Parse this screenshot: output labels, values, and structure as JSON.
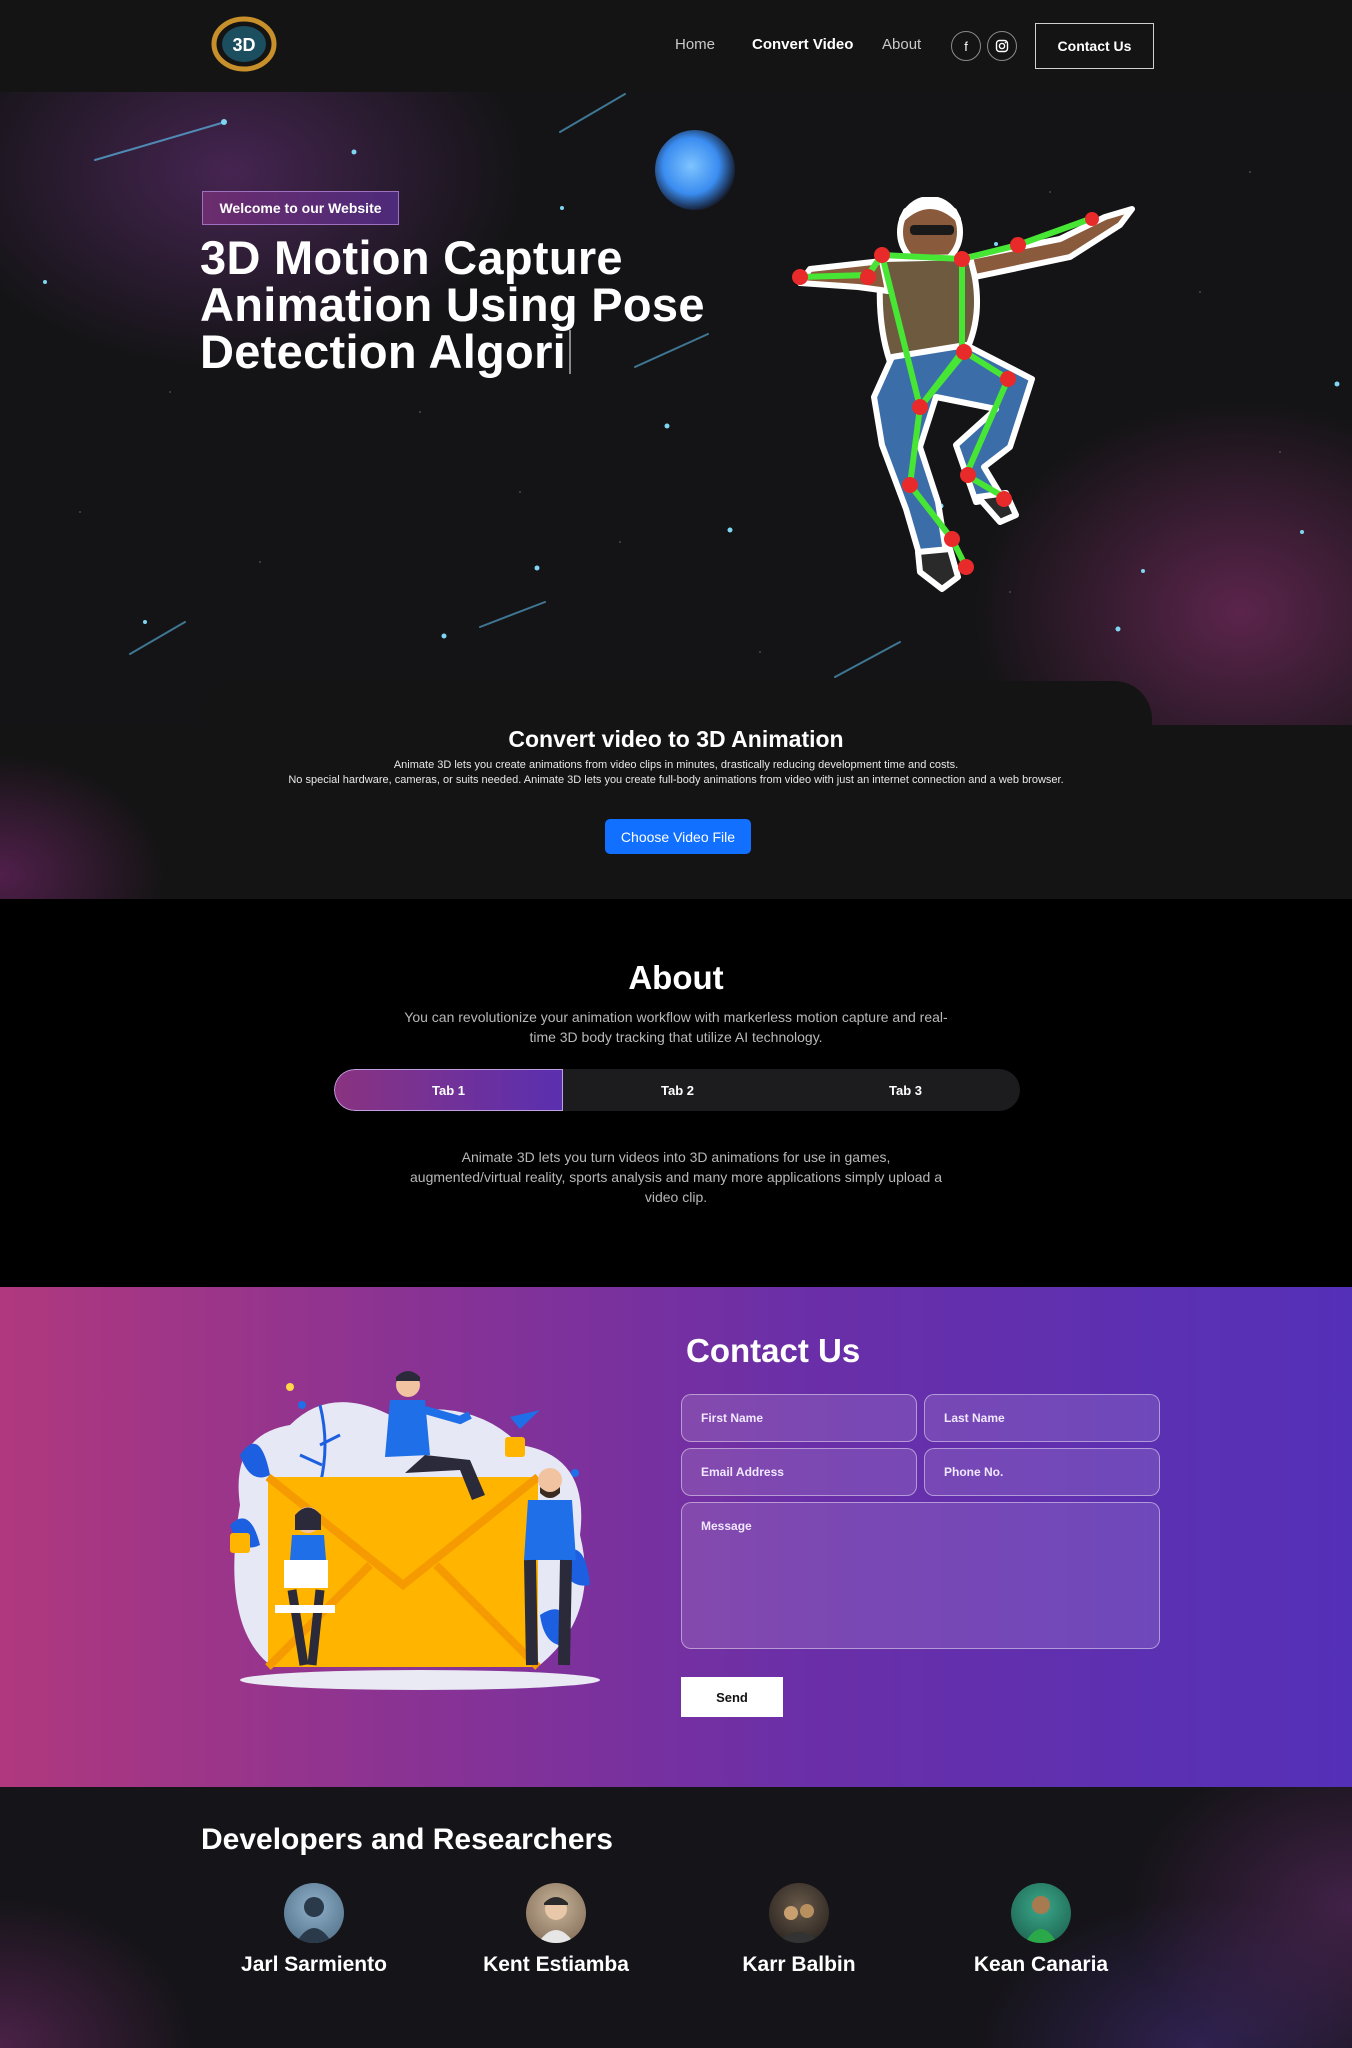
{
  "nav": {
    "logo_text": "3D",
    "links": [
      "Home",
      "Convert Video",
      "About"
    ],
    "active_link": "Convert Video",
    "social_icons": [
      "facebook-icon",
      "instagram-icon"
    ],
    "contact_label": "Contact Us"
  },
  "hero": {
    "badge": "Welcome to our Website",
    "title": "3D Motion Capture Animation Using Pose Detection Algori"
  },
  "convert": {
    "title": "Convert video to 3D Animation",
    "line1": "Animate 3D lets you create animations from video clips in minutes, drastically reducing development time and costs.",
    "line2": "No special hardware, cameras, or suits needed. Animate 3D lets you create full-body animations from video with just an internet connection and a web browser.",
    "button": "Choose Video File"
  },
  "about": {
    "title": "About",
    "subtitle": "You can revolutionize your animation workflow with markerless motion capture and real-time 3D body tracking that utilize AI technology.",
    "tabs": [
      "Tab 1",
      "Tab 2",
      "Tab 3"
    ],
    "active_tab": "Tab 1",
    "content": "Animate 3D lets you turn videos into 3D animations for use in games, augmented/virtual reality, sports analysis and many more applications simply upload a video clip."
  },
  "contact": {
    "title": "Contact Us",
    "first_name": "First Name",
    "last_name": "Last Name",
    "email": "Email Address",
    "phone": "Phone No.",
    "message": "Message",
    "send": "Send"
  },
  "developers": {
    "title": "Developers and Researchers",
    "people": [
      "Jarl Sarmiento",
      "Kent Estiamba",
      "Karr Balbin",
      "Kean Canaria"
    ]
  },
  "colors": {
    "accent_blue": "#1170ff",
    "gradient_start": "#b0387e",
    "gradient_end": "#5430b8"
  }
}
